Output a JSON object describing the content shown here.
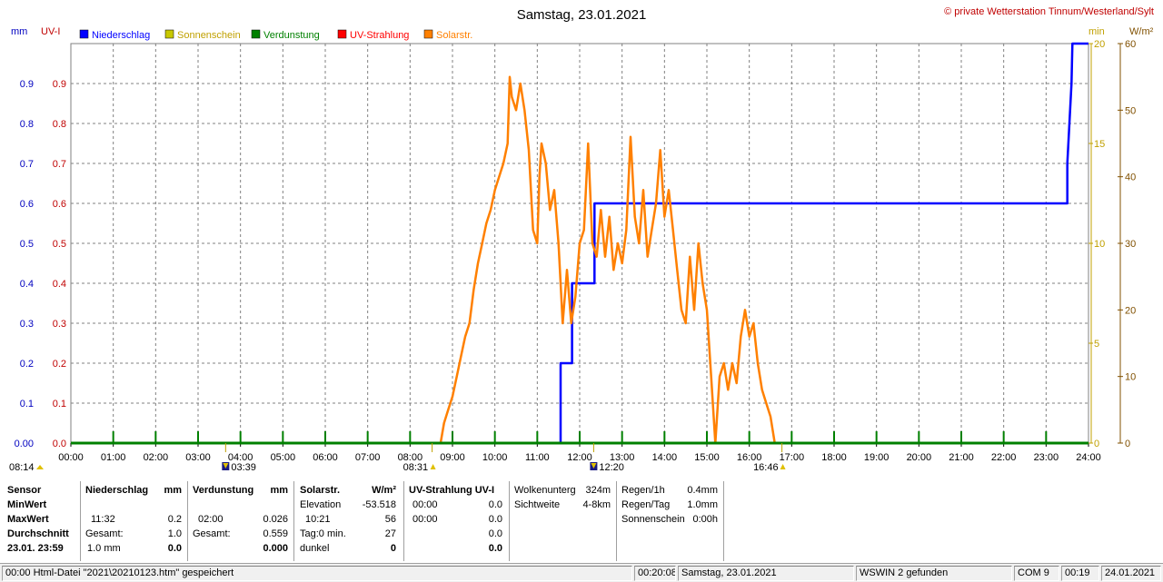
{
  "chart_data": {
    "type": "line",
    "title": "Samstag, 23.01.2021",
    "credit": "© private Wetterstation Tinnum/Westerland/Sylt",
    "left_axis_units": [
      "mm",
      "UV-I"
    ],
    "right_axis_units": [
      "min",
      "W/m²"
    ],
    "legend": [
      {
        "name": "Niederschlag",
        "color": "#0000ff"
      },
      {
        "name": "Sonnenschein",
        "color": "#c8c800"
      },
      {
        "name": "Verdunstung",
        "color": "#008000"
      },
      {
        "name": "UV-Strahlung",
        "color": "#ff0000"
      },
      {
        "name": "Solarstr.",
        "color": "#ff8000"
      }
    ],
    "colors": {
      "left_axis": "#0000c0",
      "uv_axis": "#c00000",
      "min_axis": "#c0a000",
      "solar_axis": "#805000",
      "grid": "#808080"
    },
    "x_ticks": [
      "00:00",
      "01:00",
      "02:00",
      "03:00",
      "04:00",
      "05:00",
      "06:00",
      "07:00",
      "08:00",
      "09:00",
      "10:00",
      "11:00",
      "12:00",
      "13:00",
      "14:00",
      "15:00",
      "16:00",
      "17:00",
      "18:00",
      "19:00",
      "20:00",
      "21:00",
      "22:00",
      "23:00",
      "24:00"
    ],
    "xlim": [
      0,
      24
    ],
    "y_left_ticks": [
      "0.00",
      "0.1",
      "0.2",
      "0.3",
      "0.4",
      "0.5",
      "0.6",
      "0.7",
      "0.8",
      "0.9"
    ],
    "y_uv_ticks": [
      "0.0",
      "0.1",
      "0.2",
      "0.3",
      "0.4",
      "0.5",
      "0.6",
      "0.7",
      "0.8",
      "0.9"
    ],
    "ylim_left": [
      0,
      1.0
    ],
    "y_min_ticks": [
      "0",
      "5",
      "10",
      "15",
      "20"
    ],
    "ylim_min": [
      0,
      20
    ],
    "y_solar_ticks": [
      "0",
      "10",
      "20",
      "30",
      "40",
      "50",
      "60"
    ],
    "ylim_solar": [
      0,
      60
    ],
    "time_markers": [
      {
        "label": "08:14",
        "x": 0
      },
      {
        "label": "03:39",
        "x": 3.65
      },
      {
        "label": "08:31",
        "x": 8.52
      },
      {
        "label": "12:20",
        "x": 12.33
      },
      {
        "label": "16:46",
        "x": 16.77
      }
    ],
    "series": [
      {
        "name": "Niederschlag",
        "color": "#0000ff",
        "step": true,
        "points": [
          [
            0,
            0
          ],
          [
            11.55,
            0
          ],
          [
            11.55,
            0.2
          ],
          [
            11.82,
            0.2
          ],
          [
            11.82,
            0.4
          ],
          [
            12.35,
            0.4
          ],
          [
            12.35,
            0.6
          ],
          [
            23.5,
            0.6
          ],
          [
            23.5,
            0.7
          ],
          [
            23.55,
            0.8
          ],
          [
            23.6,
            0.9
          ],
          [
            23.62,
            1.0
          ],
          [
            24,
            1.0
          ]
        ]
      },
      {
        "name": "Solarstr.",
        "color": "#ff8000",
        "points": [
          [
            8.72,
            0
          ],
          [
            8.8,
            3
          ],
          [
            8.9,
            5
          ],
          [
            9.0,
            7
          ],
          [
            9.1,
            10
          ],
          [
            9.2,
            13
          ],
          [
            9.3,
            16
          ],
          [
            9.4,
            18
          ],
          [
            9.5,
            23
          ],
          [
            9.6,
            27
          ],
          [
            9.7,
            30
          ],
          [
            9.8,
            33
          ],
          [
            9.9,
            35
          ],
          [
            10.0,
            38
          ],
          [
            10.1,
            40
          ],
          [
            10.2,
            42
          ],
          [
            10.3,
            45
          ],
          [
            10.35,
            55
          ],
          [
            10.4,
            52
          ],
          [
            10.5,
            50
          ],
          [
            10.6,
            54
          ],
          [
            10.7,
            50
          ],
          [
            10.8,
            44
          ],
          [
            10.9,
            32
          ],
          [
            11.0,
            30
          ],
          [
            11.05,
            40
          ],
          [
            11.1,
            45
          ],
          [
            11.2,
            42
          ],
          [
            11.3,
            35
          ],
          [
            11.4,
            38
          ],
          [
            11.5,
            30
          ],
          [
            11.6,
            18
          ],
          [
            11.7,
            26
          ],
          [
            11.8,
            18
          ],
          [
            11.9,
            22
          ],
          [
            12.0,
            30
          ],
          [
            12.1,
            32
          ],
          [
            12.2,
            45
          ],
          [
            12.3,
            30
          ],
          [
            12.4,
            28
          ],
          [
            12.5,
            35
          ],
          [
            12.6,
            28
          ],
          [
            12.7,
            34
          ],
          [
            12.8,
            26
          ],
          [
            12.9,
            30
          ],
          [
            13.0,
            27
          ],
          [
            13.1,
            32
          ],
          [
            13.2,
            46
          ],
          [
            13.3,
            34
          ],
          [
            13.4,
            30
          ],
          [
            13.5,
            38
          ],
          [
            13.6,
            28
          ],
          [
            13.7,
            32
          ],
          [
            13.8,
            36
          ],
          [
            13.9,
            44
          ],
          [
            14.0,
            34
          ],
          [
            14.1,
            38
          ],
          [
            14.2,
            32
          ],
          [
            14.3,
            26
          ],
          [
            14.4,
            20
          ],
          [
            14.5,
            18
          ],
          [
            14.6,
            28
          ],
          [
            14.7,
            20
          ],
          [
            14.8,
            30
          ],
          [
            14.9,
            24
          ],
          [
            15.0,
            20
          ],
          [
            15.1,
            10
          ],
          [
            15.2,
            0
          ],
          [
            15.3,
            10
          ],
          [
            15.4,
            12
          ],
          [
            15.5,
            8
          ],
          [
            15.6,
            12
          ],
          [
            15.7,
            9
          ],
          [
            15.8,
            16
          ],
          [
            15.9,
            20
          ],
          [
            16.0,
            16
          ],
          [
            16.1,
            18
          ],
          [
            16.2,
            12
          ],
          [
            16.3,
            8
          ],
          [
            16.4,
            6
          ],
          [
            16.5,
            4
          ],
          [
            16.6,
            0
          ],
          [
            24,
            0
          ]
        ]
      },
      {
        "name": "Verdunstung",
        "color": "#008000",
        "points": [
          [
            0,
            0
          ],
          [
            24,
            0
          ]
        ]
      }
    ]
  },
  "table": {
    "sensor": {
      "h": "Sensor",
      "r1": "MinWert",
      "r2": "MaxWert",
      "r3": "Durchschnitt",
      "r4": "23.01.  23:59"
    },
    "niederschlag": {
      "h": "Niederschlag",
      "u": "mm",
      "max_t": "11:32",
      "max_v": "0.2",
      "g_l": "Gesamt:",
      "g_v": "1.0",
      "d_l": "1.0 mm",
      "d_v": "0.0"
    },
    "verdunstung": {
      "h": "Verdunstung",
      "u": "mm",
      "max_t": "02:00",
      "max_v": "0.026",
      "g_l": "Gesamt:",
      "g_v": "0.559",
      "d_v": "0.000"
    },
    "solar": {
      "h": "Solarstr.",
      "u": "W/m²",
      "e_l": "Elevation",
      "e_v": "-53.518",
      "m_t": "10:21",
      "m_v": "56",
      "t_l": "Tag:0 min.",
      "t_v": "27",
      "k_l": "dunkel",
      "k_v": "0"
    },
    "uv": {
      "h": "UV-Strahlung UV-I",
      "a_t": "00:00",
      "a_v": "0.0",
      "b_t": "00:00",
      "b_v": "0.0",
      "c_v": "0.0",
      "d_v": "0.0"
    },
    "wolken": {
      "l1": "Wolkenunterg",
      "v1": "324m",
      "l2": "Sichtweite",
      "v2": "4-8km"
    },
    "regen": {
      "l1": "Regen/1h",
      "v1": "0.4mm",
      "l2": "Regen/Tag",
      "v2": "1.0mm",
      "l3": "Sonnenschein",
      "v3": "0:00h"
    }
  },
  "statusbar": [
    "00:00  Html-Datei  \"2021\\20210123.htm\"  gespeichert",
    "00:20:08",
    "Samstag, 23.01.2021",
    "WSWIN 2 gefunden",
    "COM 9",
    "00:19",
    "24.01.2021"
  ]
}
